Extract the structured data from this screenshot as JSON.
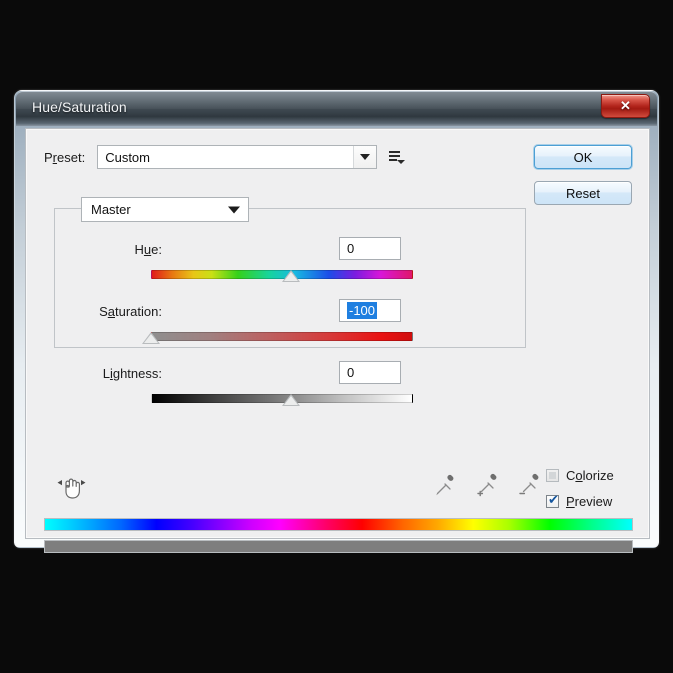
{
  "window": {
    "title": "Hue/Saturation",
    "close_label": "✕"
  },
  "preset": {
    "label": "P",
    "label_underlined": "r",
    "label_rest": "eset:",
    "full_label": "Preset:",
    "value": "Custom",
    "menu_icon": "preset-menu-icon",
    "arrow_icon": "chevron-down-icon"
  },
  "buttons": {
    "ok": "OK",
    "reset": "Reset"
  },
  "channel": {
    "value": "Master",
    "arrow_icon": "chevron-down-icon"
  },
  "adjustments": [
    {
      "name": "hue",
      "label": "Hue:",
      "label_pre": "H",
      "label_accel": "u",
      "label_post": "e:",
      "value": "0",
      "selected": false,
      "thumb_percent": 50,
      "track_type": "rainbow"
    },
    {
      "name": "saturation",
      "label": "Saturation:",
      "label_pre": "S",
      "label_accel": "a",
      "label_post": "turation:",
      "value": "-100",
      "selected": true,
      "thumb_percent": 0,
      "track_type": "saturation"
    },
    {
      "name": "lightness",
      "label": "Lightness:",
      "label_pre": "L",
      "label_accel": "i",
      "label_post": "ghtness:",
      "value": "0",
      "selected": false,
      "thumb_percent": 50,
      "track_type": "lightness"
    }
  ],
  "tools": {
    "scrub_icon": "hand-scrub-icon",
    "eyedropper": "eyedropper-icon",
    "eyedropper_add": "eyedropper-add-icon",
    "eyedropper_subtract": "eyedropper-subtract-icon"
  },
  "options": {
    "colorize": {
      "label": "Colorize",
      "label_pre": "C",
      "label_accel": "o",
      "label_post": "lorize",
      "checked": false,
      "enabled": false
    },
    "preview": {
      "label": "Preview",
      "label_pre": "",
      "label_accel": "P",
      "label_post": "review",
      "checked": true,
      "enabled": true,
      "check_glyph": "✔"
    }
  },
  "color_bars": {
    "top_name": "source-hue-spectrum-bar",
    "bottom_name": "result-color-bar",
    "bottom_color": "#7e7e7e"
  },
  "colors": {
    "dialog_bg": "#efeff0",
    "accent_selection": "#1f7fe0",
    "close_red": "#b3251c",
    "default_button_border": "#4c9fd4"
  }
}
